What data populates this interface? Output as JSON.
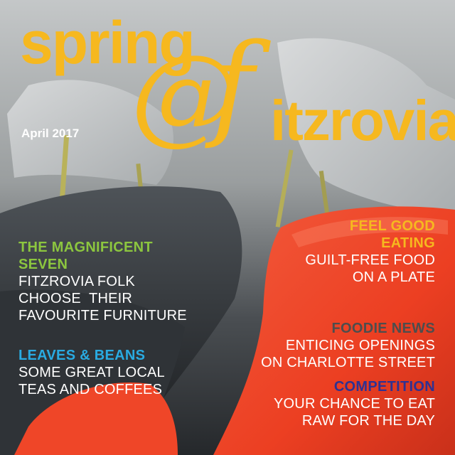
{
  "masthead": {
    "spring": "spring",
    "at_symbol": "@",
    "f_letter": "f",
    "itzrovia": "itzrovia"
  },
  "issue_date": "April 2017",
  "stories": {
    "magnificent_seven": {
      "headline_lines": [
        "THE MAGNIFICENT",
        "SEVEN"
      ],
      "sub_lines": [
        "FITZROVIA FOLK",
        "CHOOSE  THEIR",
        "FAVOURITE FURNITURE"
      ],
      "color": "#8cc63f"
    },
    "leaves_beans": {
      "headline_lines": [
        "LEAVES & BEANS"
      ],
      "sub_lines": [
        "SOME GREAT LOCAL",
        "TEAS AND COFFEES"
      ],
      "color": "#29abe2"
    },
    "feel_good": {
      "headline_lines": [
        "FEEL GOOD",
        "EATING"
      ],
      "sub_lines": [
        "GUILT-FREE FOOD",
        "ON A PLATE"
      ],
      "color": "#f6b81f"
    },
    "foodie_news": {
      "headline_lines": [
        "FOODIE NEWS"
      ],
      "sub_lines": [
        "ENTICING OPENINGS",
        "ON CHARLOTTE STREET"
      ],
      "color": "#4d4d4d"
    },
    "competition": {
      "headline_lines": [
        "COMPETITION"
      ],
      "sub_lines": [
        "YOUR CHANCE TO EAT",
        "RAW FOR THE DAY"
      ],
      "color": "#2e3192"
    }
  },
  "colors": {
    "masthead": "#f6b81f",
    "chair_red": "#f0472b",
    "chair_dark": "#33373b",
    "chair_light": "#c9ccce"
  }
}
